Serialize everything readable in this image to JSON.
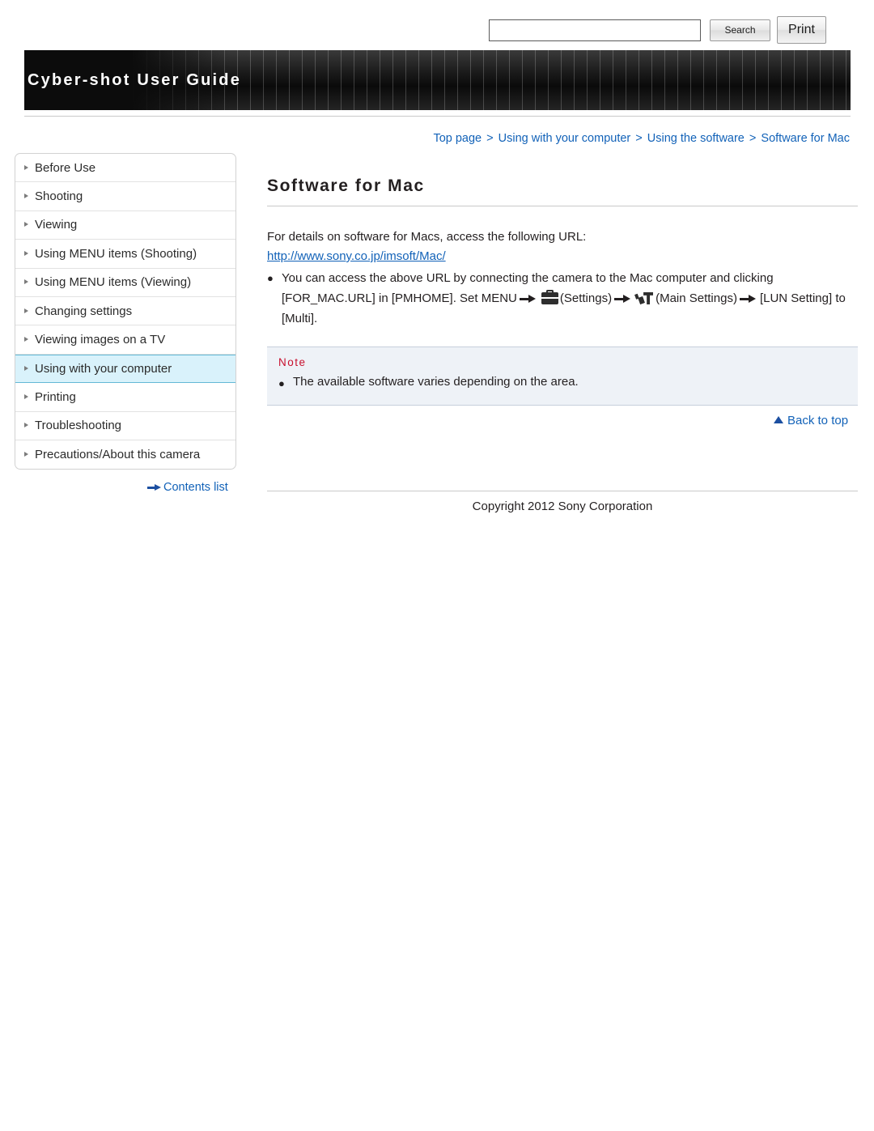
{
  "header": {
    "title": "Cyber-shot User Guide",
    "search_value": "",
    "search_placeholder": "",
    "search_label": "Search",
    "print_label": "Print"
  },
  "breadcrumb": {
    "items": [
      "Top page",
      "Using with your computer",
      "Using the software",
      "Software for Mac"
    ],
    "separator": ">"
  },
  "sidebar": {
    "items": [
      {
        "label": "Before Use",
        "active": false
      },
      {
        "label": "Shooting",
        "active": false
      },
      {
        "label": "Viewing",
        "active": false
      },
      {
        "label": "Using MENU items (Shooting)",
        "active": false
      },
      {
        "label": "Using MENU items (Viewing)",
        "active": false
      },
      {
        "label": "Changing settings",
        "active": false
      },
      {
        "label": "Viewing images on a TV",
        "active": false
      },
      {
        "label": "Using with your computer",
        "active": true
      },
      {
        "label": "Printing",
        "active": false
      },
      {
        "label": "Troubleshooting",
        "active": false
      },
      {
        "label": "Precautions/About this camera",
        "active": false
      }
    ],
    "contents_list_label": "Contents list"
  },
  "main": {
    "title": "Software for Mac",
    "intro": "For details on software for Macs, access the following URL:",
    "url": "http://www.sony.co.jp/imsoft/Mac/",
    "bullet_dot": "●",
    "bullet_part1": "You can access the above URL by connecting the camera to the Mac computer and clicking [FOR_MAC.URL] in [PMHOME]. Set MENU",
    "bullet_part2": "(Settings)",
    "bullet_part3": "(Main Settings)",
    "bullet_part4": "[LUN Setting] to [Multi].",
    "note_label": "Note",
    "note_text": "The available software varies depending on the area.",
    "back_to_top": "Back to top"
  },
  "footer": {
    "copyright": "Copyright 2012 Sony Corporation"
  }
}
